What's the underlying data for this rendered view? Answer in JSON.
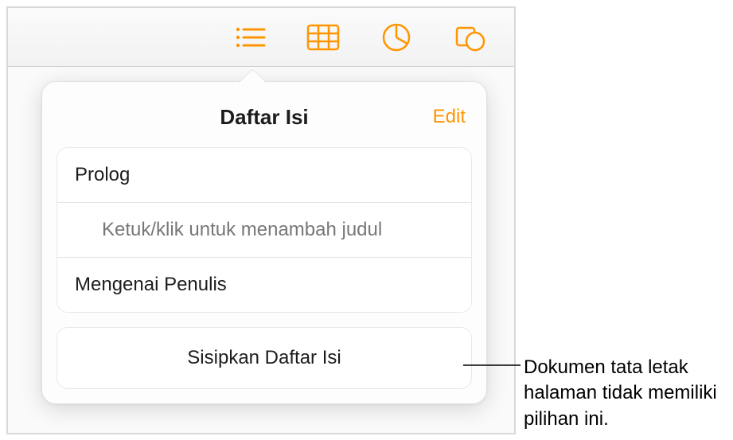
{
  "toolbar": {
    "icons": {
      "toc": "list-bullets-icon",
      "table": "table-icon",
      "chart": "pie-chart-icon",
      "shape": "shape-icon"
    }
  },
  "popover": {
    "title": "Daftar Isi",
    "edit_label": "Edit",
    "toc_items": [
      {
        "label": "Prolog",
        "indent": false
      },
      {
        "label": "Ketuk/klik untuk menambah judul",
        "indent": true
      },
      {
        "label": "Mengenai Penulis",
        "indent": false
      }
    ],
    "insert_label": "Sisipkan Daftar Isi"
  },
  "callout": {
    "text": "Dokumen tata letak halaman tidak memiliki pilihan ini."
  },
  "colors": {
    "accent": "#ff9500"
  }
}
